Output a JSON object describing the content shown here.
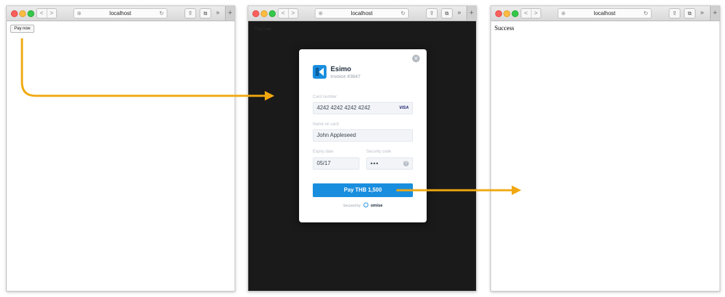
{
  "browser": {
    "url": "localhost",
    "nav_back": "<",
    "nav_forward": ">",
    "more_chevron": "»",
    "new_tab": "+"
  },
  "step1": {
    "pay_button_label": "Pay now"
  },
  "step2": {
    "background_pay_label": "Pay now",
    "modal": {
      "merchant_name": "Esimo",
      "invoice": "Invoice #3847",
      "card_number_label": "Card number",
      "card_number_value": "4242 4242 4242 4242",
      "card_brand": "VISA",
      "name_label": "Name on card",
      "name_value": "John Appleseed",
      "expiry_label": "Expiry date",
      "expiry_value": "05/17",
      "security_label": "Security code",
      "security_value": "•••",
      "pay_button_label": "Pay THB 1,500",
      "secured_by": "Secured by",
      "provider": "omise"
    }
  },
  "step3": {
    "result_text": "Success"
  },
  "colors": {
    "arrow": "#f1a80f",
    "pay_button": "#1a8ede",
    "overlay": "#1a1a1a"
  }
}
